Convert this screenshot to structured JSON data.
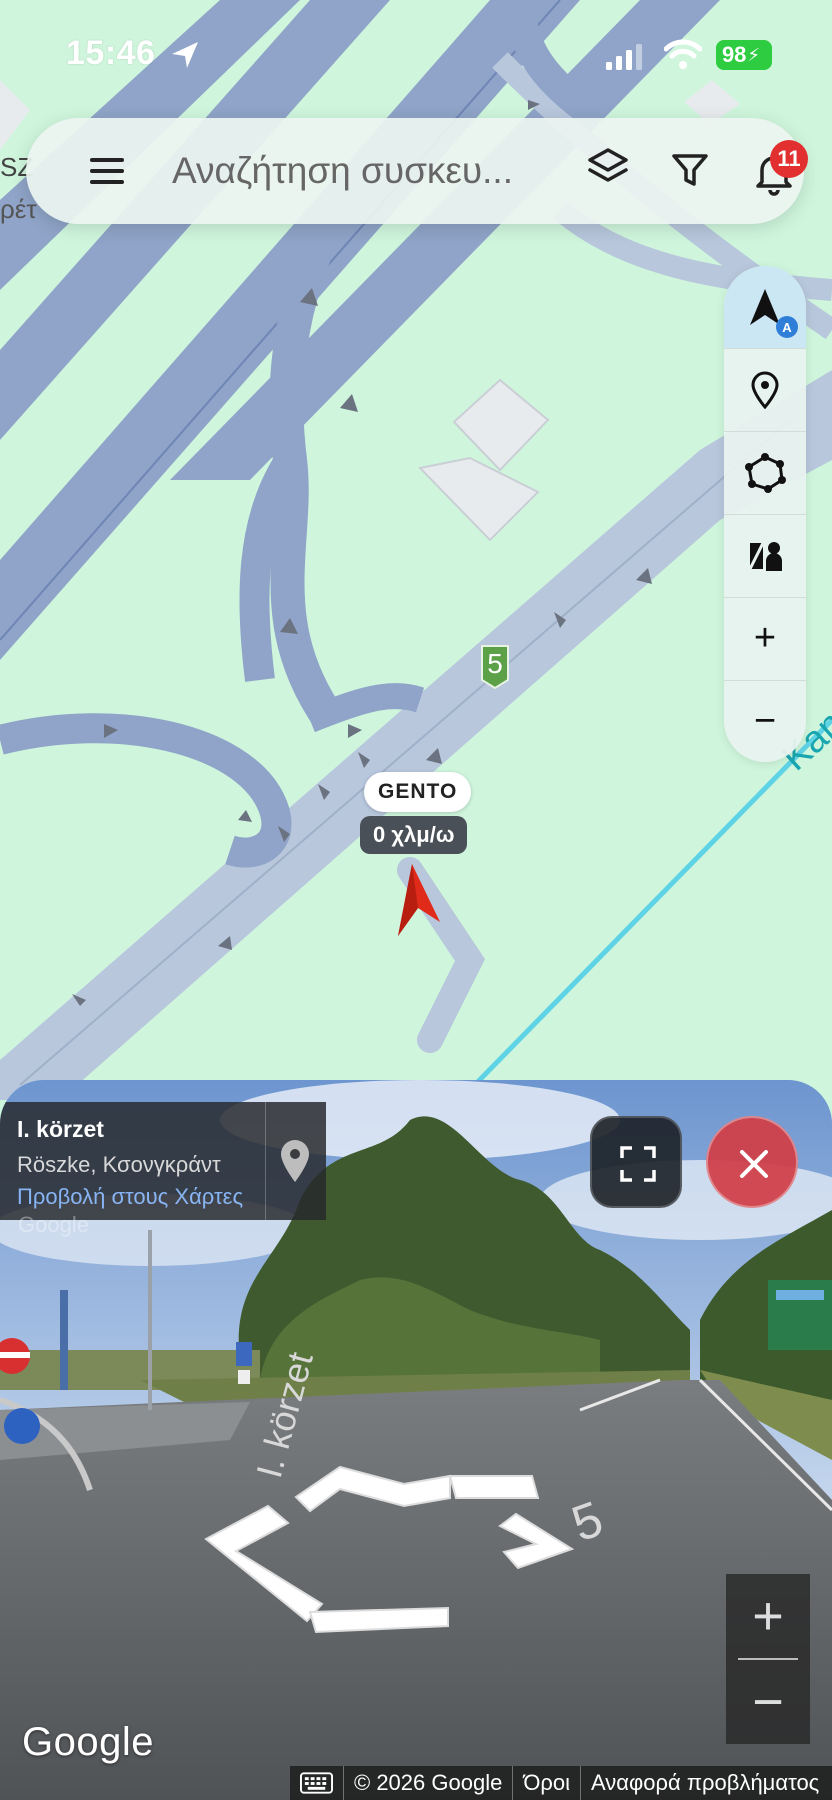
{
  "status_bar": {
    "time": "15:46",
    "battery": "98"
  },
  "search": {
    "placeholder": "Αναζήτηση συσκευ...",
    "notification_count": "11"
  },
  "map": {
    "route_shield": "5",
    "vehicle": {
      "name": "GENTO",
      "speed": "0 χλμ/ω"
    },
    "labels": {
      "kan": "Kan",
      "sz": "SZ",
      "ret": "ρέτ"
    },
    "controls": {
      "auto_badge": "A",
      "zoom_in": "+",
      "zoom_out": "−"
    }
  },
  "street_view": {
    "place_title": "I. körzet",
    "place_subtitle": "Röszke, Κσονγκράντ",
    "place_link": "Προβολή στους Χάρτες",
    "google_watermark": "Google",
    "zoom_in": "+",
    "zoom_out": "−",
    "road_label": "I. körzet",
    "road_number": "5"
  },
  "footer": {
    "google_logo": "Google",
    "copyright": "© 2026 Google",
    "terms": "Όροι",
    "report": "Αναφορά προβλήματος"
  },
  "colors": {
    "map_bg": "#cff6dd",
    "road": "#8fa4c8",
    "road_light": "#b8c7dc",
    "vehicle_marker": "#e02a1a",
    "badge_red": "#e1302f",
    "battery_green": "#2ecc40",
    "close_red": "#d0404a",
    "link_blue": "#88b4f4",
    "river": "#5fd3e6"
  }
}
